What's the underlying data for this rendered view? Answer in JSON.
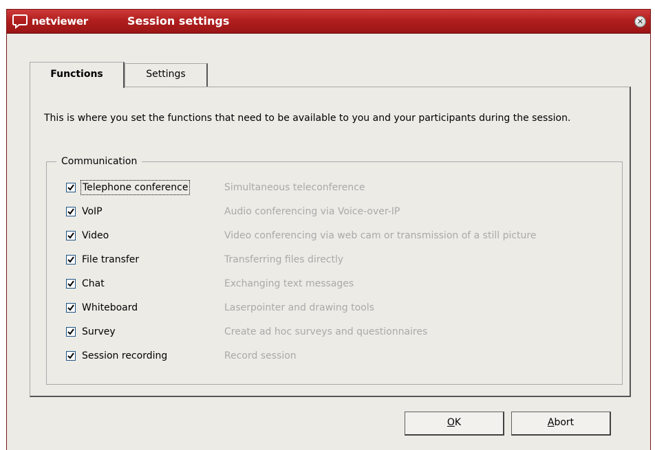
{
  "window": {
    "logo_text": "netviewer",
    "title": "Session settings",
    "close_symbol": "✕"
  },
  "tabs": [
    {
      "label": "Functions",
      "active": true
    },
    {
      "label": "Settings",
      "active": false
    }
  ],
  "description": "This is where you set the functions that need to be available to you and your participants during the session.",
  "communication": {
    "legend": "Communication",
    "items": [
      {
        "label": "Telephone conference",
        "description": "Simultaneous teleconference",
        "checked": true
      },
      {
        "label": "VoIP",
        "description": "Audio conferencing via Voice-over-IP",
        "checked": true
      },
      {
        "label": "Video",
        "description": "Video conferencing via web cam or transmission of a still picture",
        "checked": true
      },
      {
        "label": "File transfer",
        "description": "Transferring files directly",
        "checked": true
      },
      {
        "label": "Chat",
        "description": "Exchanging text messages",
        "checked": true
      },
      {
        "label": "Whiteboard",
        "description": "Laserpointer and drawing tools",
        "checked": true
      },
      {
        "label": "Survey",
        "description": "Create ad hoc surveys and questionnaires",
        "checked": true
      },
      {
        "label": "Session recording",
        "description": "Record session",
        "checked": true
      }
    ]
  },
  "buttons": {
    "ok": {
      "mnemonic": "O",
      "rest": "K"
    },
    "abort": {
      "mnemonic": "A",
      "rest": "bort"
    }
  },
  "colors": {
    "titlebar": "#b21f1f",
    "dialog_bg": "#ecebe6",
    "disabled_text": "#a9a9a9"
  }
}
